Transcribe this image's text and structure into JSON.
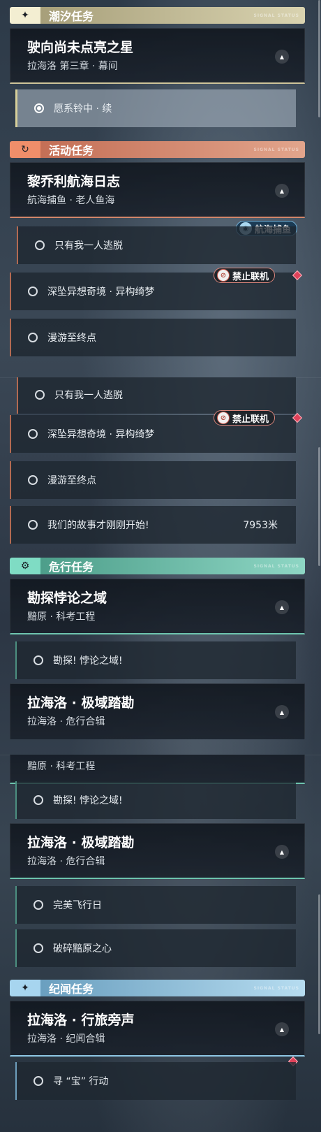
{
  "panel1": {
    "cat_tide": {
      "icon": "sparkle-icon",
      "label": "潮汐任务"
    },
    "card_tide": {
      "title": "驶向尚未点亮之星",
      "sub": "拉海洛 第三章 · 幕间"
    },
    "task_tide": {
      "label": "愿系铃中 · 续"
    },
    "cat_event": {
      "icon": "refresh-icon",
      "label": "活动任务"
    },
    "card_event": {
      "title": "黎乔利航海日志",
      "sub": "航海捕鱼 · 老人鱼海"
    },
    "tag_fishing": "航海捕鱼",
    "tasks": [
      {
        "label": "只有我一人逃脱"
      },
      {
        "label": "深坠异想奇境 · 异构绮梦"
      },
      {
        "label": "漫游至终点"
      }
    ],
    "tag_no_online": "禁止联机"
  },
  "panel2": {
    "tasks": [
      {
        "label": "只有我一人逃脱"
      },
      {
        "label": "深坠异想奇境 · 异构绮梦"
      },
      {
        "label": "漫游至终点"
      },
      {
        "label": "我们的故事才刚刚开始!",
        "distance": "7953米"
      }
    ],
    "tag_no_online": "禁止联机",
    "cat_danger": {
      "icon": "gear-icon",
      "label": "危行任务"
    },
    "card_explore": {
      "title": "勘探悖论之域",
      "sub": "黯原 · 科考工程"
    },
    "task_explore": {
      "label": "勘探! 悖论之域!"
    },
    "card_polar": {
      "title": "拉海洛 · 极域踏勘",
      "sub": "拉海洛 · 危行合辑"
    }
  },
  "panel3": {
    "card_explore_sub": "黯原 · 科考工程",
    "task_explore": {
      "label": "勘探! 悖论之域!"
    },
    "card_polar": {
      "title": "拉海洛 · 极域踏勘",
      "sub": "拉海洛 · 危行合辑"
    },
    "tasks_polar": [
      {
        "label": "完美飞行日"
      },
      {
        "label": "破碎黯原之心"
      }
    ],
    "cat_lore": {
      "icon": "sparkle-icon",
      "label": "纪闻任务"
    },
    "card_lore": {
      "title": "拉海洛 · 行旅旁声",
      "sub": "拉海洛 · 纪闻合辑"
    },
    "task_lore": {
      "label": "寻 “宝” 行动"
    }
  },
  "deco_text": "SIGNAL STATUS",
  "colors": {
    "tide": "#cfc59a",
    "event": "#d2866a",
    "danger": "#6dc4ae",
    "lore": "#8ec6e4",
    "track_marker": "#e0425a"
  }
}
